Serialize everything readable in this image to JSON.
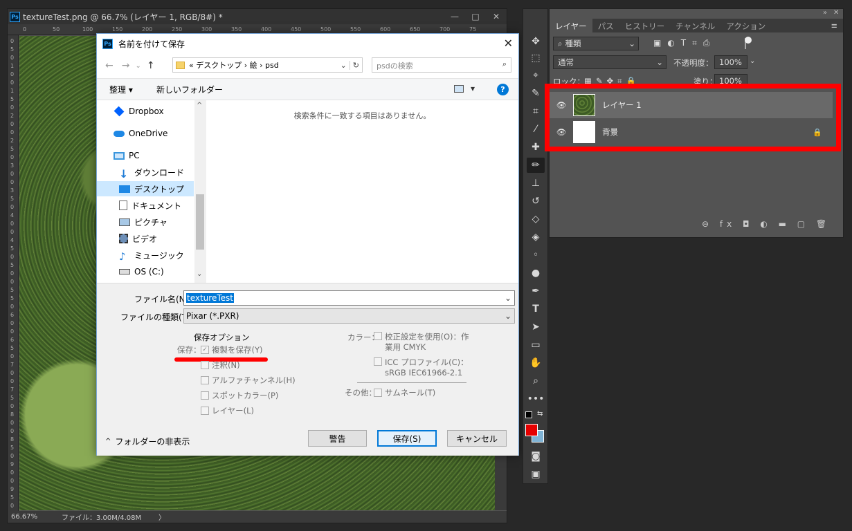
{
  "doc": {
    "title": "textureTest.png @ 66.7% (レイヤー 1, RGB/8#) *",
    "app_badge": "Ps",
    "minimize": "—",
    "maximize": "□",
    "close": "✕",
    "ruler_h": [
      "0",
      "50",
      "100",
      "150",
      "200",
      "250",
      "300",
      "350",
      "400",
      "450",
      "500",
      "550",
      "600",
      "650",
      "700",
      "75"
    ],
    "ruler_v": [
      "0",
      "5",
      "0",
      "1",
      "0",
      "0",
      "1",
      "5",
      "0",
      "2",
      "0",
      "0",
      "2",
      "5",
      "0",
      "3",
      "0",
      "0",
      "3",
      "5",
      "0",
      "4",
      "0",
      "0",
      "4",
      "5",
      "0",
      "5",
      "0",
      "0",
      "5",
      "5",
      "0",
      "6",
      "0",
      "0",
      "6",
      "5",
      "0",
      "7",
      "0",
      "0",
      "7",
      "5",
      "0",
      "8",
      "0",
      "0",
      "8",
      "5",
      "0",
      "9",
      "0",
      "0",
      "9",
      "5",
      "0"
    ],
    "zoom": "66.67%",
    "file_info": "ファイル：3.00M/4.08M",
    "status_arrow": "〉"
  },
  "dialog": {
    "title": "名前を付けて保存",
    "close": "✕",
    "nav_back": "←",
    "nav_forward": "→",
    "nav_recent": "⌄",
    "nav_up": "↑",
    "breadcrumb": "« デスクトップ › 絵 › psd",
    "breadcrumb_dropdown": "⌄",
    "refresh": "↻",
    "search_placeholder": "psdの検索",
    "search_icon": "⌕",
    "organize": "整理 ▾",
    "new_folder": "新しいフォルダー",
    "view_arrow": "▾",
    "help": "?",
    "nav_items": [
      "Dropbox",
      "OneDrive",
      "PC",
      "ダウンロード",
      "デスクトップ",
      "ドキュメント",
      "ピクチャ",
      "ビデオ",
      "ミュージック",
      "OS (C:)"
    ],
    "nav_scroll_up": "^",
    "nav_scroll_down": "⌄",
    "empty_message": "検索条件に一致する項目はありません。",
    "filename_label": "ファイル名(N):",
    "filename_value": "textureTest",
    "filetype_label": "ファイルの種類(T):",
    "filetype_value": "Pixar (*.PXR)",
    "dropdown_arrow": "⌄",
    "save_options_label": "保存オプション",
    "save_label": "保存：",
    "copy_save": "複製を保存(Y)",
    "annotations": "注釈(N)",
    "alpha": "アルファチャンネル(H)",
    "spot": "スポットカラー(P)",
    "layers": "レイヤー(L)",
    "color_label": "カラー：",
    "proof_setup_1": "校正設定を使用(O)：作",
    "proof_setup_2": "業用 CMYK",
    "icc_1": "ICC プロファイル(C)：",
    "icc_2": "sRGB IEC61966-2.1",
    "other_label": "その他：",
    "thumbnail": "サムネール(T)",
    "hide_folders": "フォルダーの非表示",
    "hide_chevron": "^",
    "warning_btn": "警告",
    "save_btn": "保存(S)",
    "cancel_btn": "キャンセル",
    "checkmark": "✓"
  },
  "layers_panel": {
    "collapse": "»",
    "close": "✕",
    "menu": "≡",
    "tabs": [
      "レイヤー",
      "パス",
      "ヒストリー",
      "チャンネル",
      "アクション"
    ],
    "filter_label": "種類",
    "blend_mode": "通常",
    "opacity_label": "不透明度：",
    "opacity_value": "100%",
    "lock_label": "ロック：",
    "fill_label": "塗り：",
    "fill_value": "100%",
    "layer_rows": [
      {
        "name": "レイヤー 1"
      },
      {
        "name": "背景"
      }
    ],
    "footer_icons": "⊖  fx  ◘  ◐  ▬  ▢  🗑"
  },
  "colors": {
    "highlight_red": "#ff0000",
    "foreground": "#e60000",
    "background": "#7fb3d5",
    "accent": "#0078d7"
  }
}
